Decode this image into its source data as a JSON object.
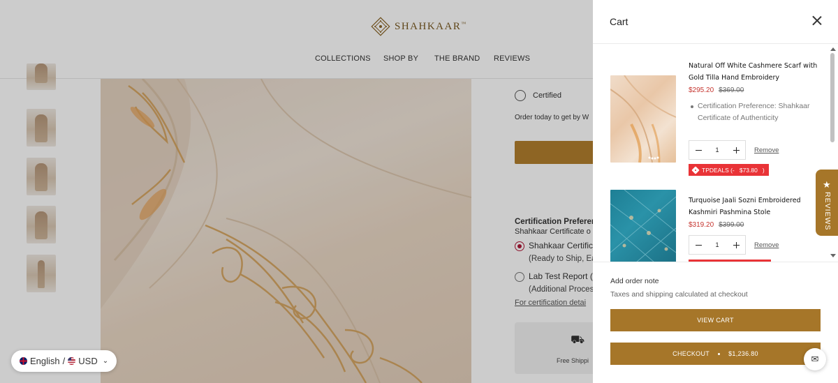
{
  "header": {
    "logo_text": "SHAHKAAR",
    "logo_mark": "™",
    "nav": [
      "COLLECTIONS",
      "SHOP BY",
      "THE BRAND",
      "REVIEWS"
    ]
  },
  "product_info": {
    "certified_label": "Certified",
    "order_today_text": "Order today to get by W",
    "cert_pref_title": "Certification Preferen",
    "cert_pref_sub": "Shahkaar Certificate o",
    "options": [
      {
        "label": "Shahkaar Certifica",
        "sub": "(Ready to Ship, Ea",
        "selected": true
      },
      {
        "label": "Lab Test Report (",
        "sub": "(Additional Proces",
        "selected": false
      }
    ],
    "cert_details_link": "For certification detai",
    "shipping_text": "Free Shippi"
  },
  "locale": {
    "language": "English",
    "separator": "/",
    "currency": "USD"
  },
  "cart": {
    "title": "Cart",
    "items": [
      {
        "name": "Natural Off White Cashmere Scarf with Gold Tilla Hand Embroidery",
        "sale_price": "$295.20",
        "old_price": "$369.00",
        "option": "Certification Preference: Shahkaar Certificate of Authenticity",
        "quantity": "1",
        "remove_label": "Remove",
        "discount": "TPDEALS (-   $73.80   )"
      },
      {
        "name": "Turquoise Jaali Sozni Embroidered Kashmiri Pashmina Stole",
        "sale_price": "$319.20",
        "old_price": "$399.00",
        "quantity": "1",
        "remove_label": "Remove"
      }
    ],
    "add_note_label": "Add order note",
    "taxes_text": "Taxes and shipping calculated at checkout",
    "view_cart_label": "VIEW CART",
    "checkout_label": "CHECKOUT",
    "checkout_total": "$1,236.80"
  },
  "reviews_tab_label": "REVIEWS",
  "colors": {
    "accent": "#a67629",
    "sale": "#c5342e",
    "discount_badge": "#e93337",
    "selected_radio": "#b01838"
  }
}
